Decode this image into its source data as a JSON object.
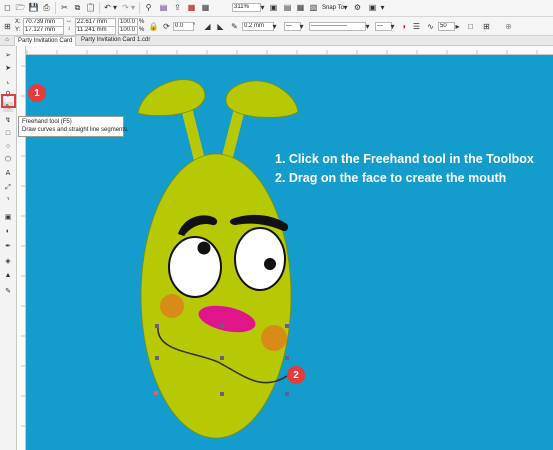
{
  "toolbar": {
    "zoom_value": "311%",
    "snap_to_label": "Snap To",
    "icons": [
      "new-document-icon",
      "open-icon",
      "save-icon",
      "print-icon",
      "cut-icon",
      "copy-icon",
      "paste-icon",
      "undo-icon",
      "redo-icon",
      "search-icon",
      "import-icon",
      "export-icon",
      "publish-icon",
      "app-launcher-icon",
      "full-screen-icon",
      "show-rulers-icon",
      "show-grid-icon",
      "show-guidelines-icon",
      "options-icon",
      "launch-icon"
    ]
  },
  "property_bar": {
    "x_label": "X:",
    "x_value": "70.739 mm",
    "y_label": "Y:",
    "y_value": "17.127 mm",
    "width_value": "22.617 mm",
    "height_value": "11.241 mm",
    "scale_x": "100.0",
    "scale_y": "100.0",
    "percent": "%",
    "rotation_value": "0.0",
    "outline_width": "0.2 mm",
    "smoothing_value": "50"
  },
  "document_tabs": [
    {
      "label": "Party Invitation Card",
      "active": true
    },
    {
      "label": "Party Invitation Card 1.cdr",
      "active": false
    }
  ],
  "toolbox": {
    "tools": [
      "pick-tool-icon",
      "shape-tool-icon",
      "crop-tool-icon",
      "zoom-tool-icon",
      "freehand-tool-icon",
      "smart-drawing-icon",
      "rectangle-tool-icon",
      "ellipse-tool-icon",
      "polygon-tool-icon",
      "text-tool-icon",
      "parallel-dimension-icon",
      "connector-tool-icon",
      "drop-shadow-icon",
      "transparency-icon",
      "color-eyedropper-icon",
      "interactive-fill-icon",
      "smart-fill-icon",
      "outline-pen-icon"
    ]
  },
  "tooltip": {
    "title": "Freehand tool (F5)",
    "description": "Draw curves and straight line segments."
  },
  "instructions": {
    "line1": "1. Click on the Freehand tool in the Toolbox",
    "line2": "2. Drag on the face to create the mouth"
  },
  "badges": {
    "step1": "1",
    "step2": "2"
  },
  "colors": {
    "canvas_background": "#149ccc",
    "creature_body": "#b6c904",
    "cheeks": "#d98b18",
    "nose": "#e0158a",
    "badge": "#e53b3b",
    "highlight_box": "#e53b3b"
  }
}
